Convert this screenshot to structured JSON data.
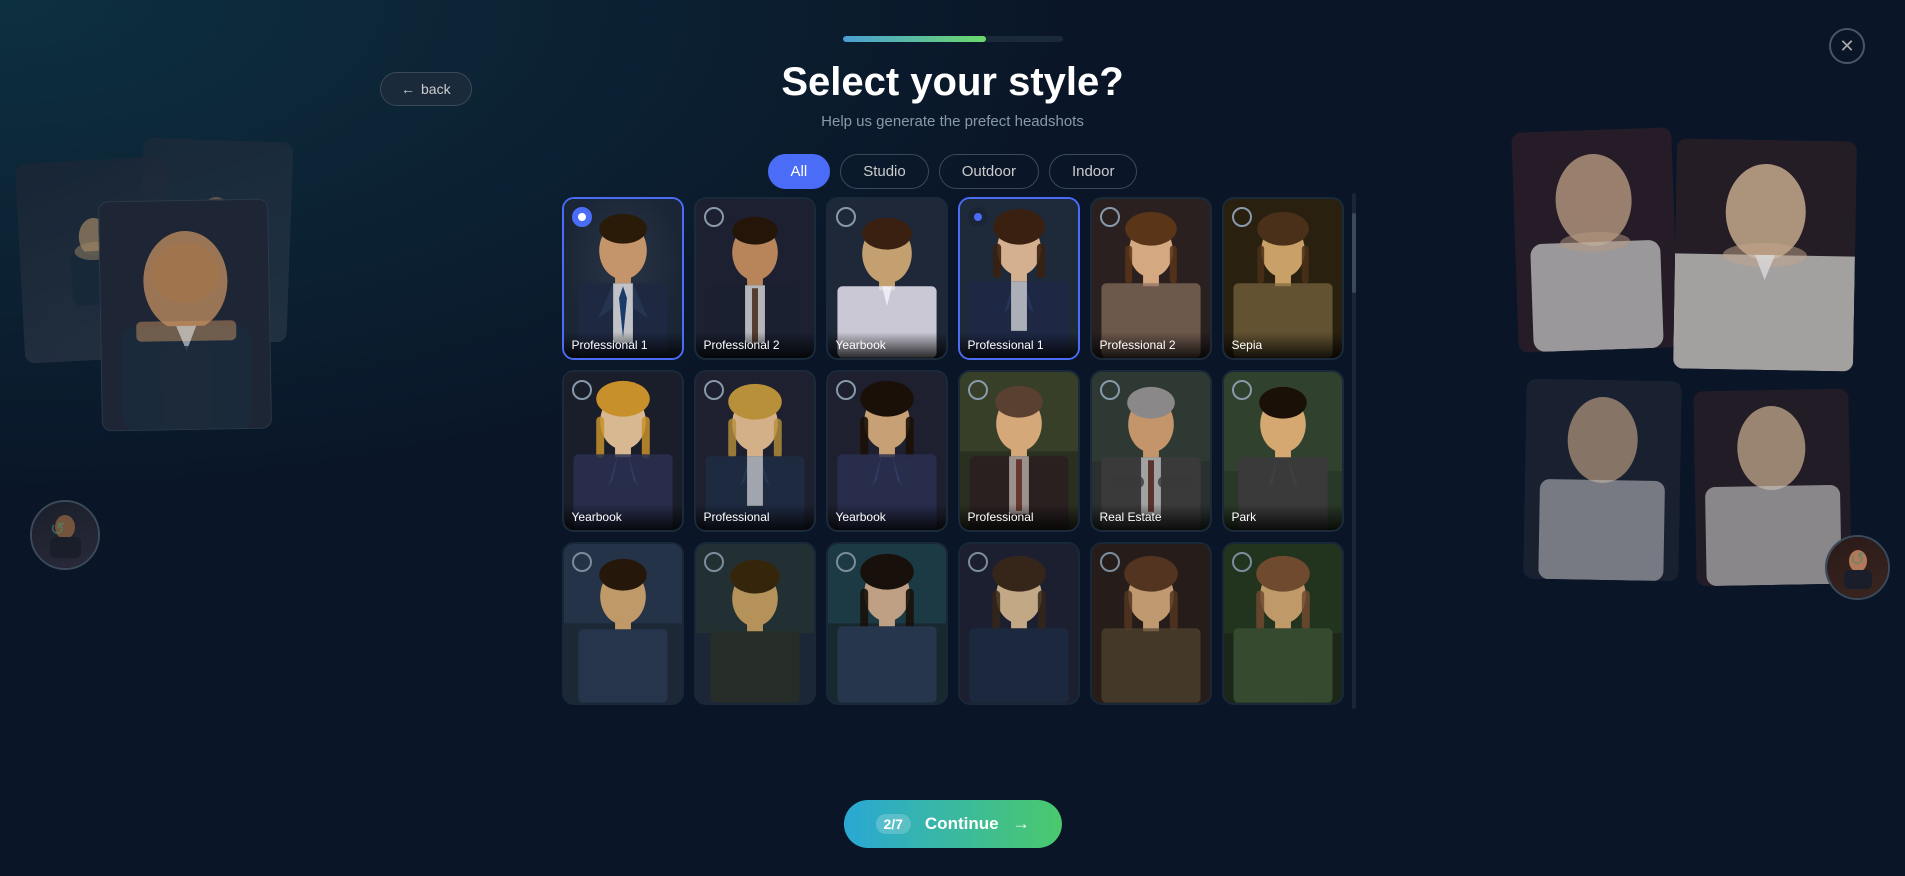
{
  "page": {
    "title": "Select your style?",
    "subtitle": "Help us generate the prefect headshots",
    "progress_width": "65%",
    "step": "2/7",
    "continue_label": "Continue",
    "back_label": "back",
    "close_label": "✕"
  },
  "filters": {
    "active": "All",
    "tabs": [
      "All",
      "Studio",
      "Outdoor",
      "Indoor"
    ]
  },
  "styles": [
    {
      "id": 1,
      "label": "Professional 1",
      "row": 1,
      "selected": "blue",
      "gender": "male",
      "bg": "#1a2535"
    },
    {
      "id": 2,
      "label": "Professional 2",
      "row": 1,
      "selected": "none",
      "gender": "male",
      "bg": "#1c2535"
    },
    {
      "id": 3,
      "label": "Yearbook",
      "row": 1,
      "selected": "none",
      "gender": "male",
      "bg": "#1e2838"
    },
    {
      "id": 4,
      "label": "Professional 1",
      "row": 1,
      "selected": "dark",
      "gender": "female",
      "bg": "#1e2a3a"
    },
    {
      "id": 5,
      "label": "Professional 2",
      "row": 1,
      "selected": "none",
      "gender": "female",
      "bg": "#2a2020"
    },
    {
      "id": 6,
      "label": "Sepia",
      "row": 1,
      "selected": "none",
      "gender": "female",
      "bg": "#2a2010"
    },
    {
      "id": 7,
      "label": "Yearbook",
      "row": 2,
      "selected": "none",
      "gender": "female2",
      "bg": "#1a1e2a"
    },
    {
      "id": 8,
      "label": "Professional",
      "row": 2,
      "selected": "none",
      "gender": "female2",
      "bg": "#1e2030"
    },
    {
      "id": 9,
      "label": "Yearbook",
      "row": 2,
      "selected": "none",
      "gender": "female3",
      "bg": "#1e2030"
    },
    {
      "id": 10,
      "label": "Professional",
      "row": 2,
      "selected": "none",
      "gender": "male2",
      "bg": "#2a2010"
    },
    {
      "id": 11,
      "label": "Real Estate",
      "row": 2,
      "selected": "none",
      "gender": "male2",
      "bg": "#1a2030"
    },
    {
      "id": 12,
      "label": "Park",
      "row": 2,
      "selected": "none",
      "gender": "male3",
      "bg": "#1a2a20"
    },
    {
      "id": 13,
      "label": "",
      "row": 3,
      "selected": "none",
      "gender": "male4",
      "bg": "#1e2a38"
    },
    {
      "id": 14,
      "label": "",
      "row": 3,
      "selected": "none",
      "gender": "male5",
      "bg": "#1e2838"
    },
    {
      "id": 15,
      "label": "",
      "row": 3,
      "selected": "none",
      "gender": "female4",
      "bg": "#1a2a30"
    },
    {
      "id": 16,
      "label": "",
      "row": 3,
      "selected": "none",
      "gender": "female5",
      "bg": "#1e2030"
    },
    {
      "id": 17,
      "label": "",
      "row": 3,
      "selected": "none",
      "gender": "female6",
      "bg": "#2a1e1a"
    },
    {
      "id": 18,
      "label": "",
      "row": 3,
      "selected": "none",
      "gender": "female7",
      "bg": "#1e2818"
    }
  ],
  "portrait_colors": {
    "male_suit_dark": "#1a2235",
    "male_suit_mid": "#2a3548",
    "female_suit_navy": "#1e2a45",
    "female_neutral": "#6a5a4a",
    "skin_light": "#d4a882",
    "skin_tan": "#c49060",
    "hair_dark": "#2a1a08",
    "hair_brown": "#5a3a18",
    "hair_blonde": "#b8903a"
  }
}
